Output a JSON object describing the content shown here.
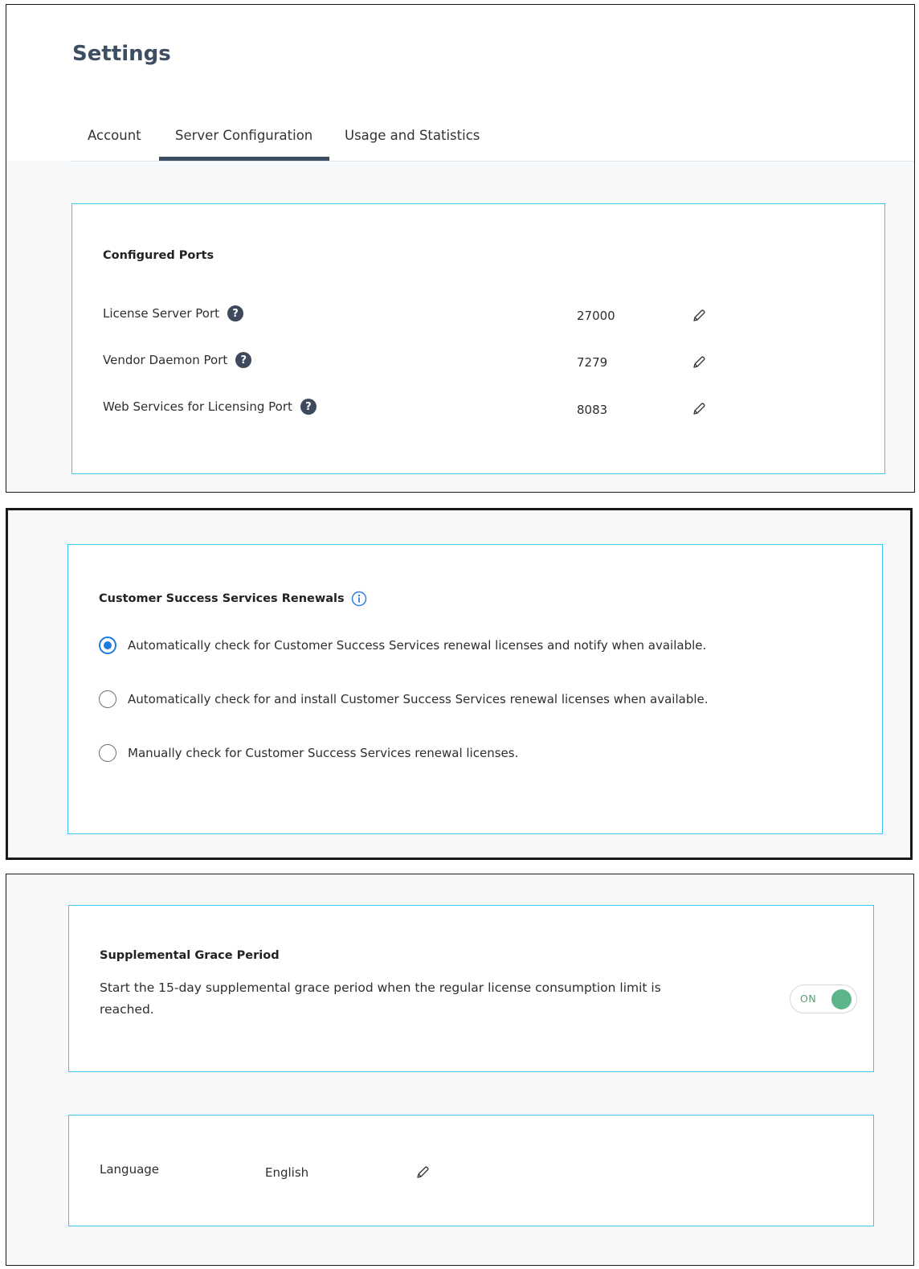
{
  "page": {
    "title": "Settings"
  },
  "tabs": [
    {
      "label": "Account",
      "active": false
    },
    {
      "label": "Server Configuration",
      "active": true
    },
    {
      "label": "Usage and Statistics",
      "active": false
    }
  ],
  "ports": {
    "title": "Configured Ports",
    "rows": [
      {
        "label": "License Server Port",
        "value": "27000"
      },
      {
        "label": "Vendor Daemon Port",
        "value": "7279"
      },
      {
        "label": "Web Services for Licensing Port",
        "value": "8083"
      }
    ],
    "help_glyph": "?"
  },
  "renewals": {
    "title": "Customer Success Services Renewals",
    "options": [
      {
        "label": "Automatically check for Customer Success Services renewal licenses and notify when available.",
        "selected": true
      },
      {
        "label": "Automatically check for and install Customer Success Services renewal licenses when available.",
        "selected": false
      },
      {
        "label": "Manually check for Customer Success Services renewal licenses.",
        "selected": false
      }
    ]
  },
  "grace": {
    "title": "Supplemental Grace Period",
    "description": "Start the 15-day supplemental grace period when the regular license consumption limit is reached.",
    "toggle_label": "ON",
    "toggle_on": true
  },
  "language": {
    "label": "Language",
    "value": "English"
  },
  "icons": {
    "help": "question-circle-icon",
    "edit": "pencil-icon",
    "info": "info-circle-icon"
  },
  "colors": {
    "accent_border": "#3ec7ee",
    "title": "#3d4e63",
    "radio_selected": "#1f7ae0",
    "toggle_on": "#5fb58a"
  }
}
